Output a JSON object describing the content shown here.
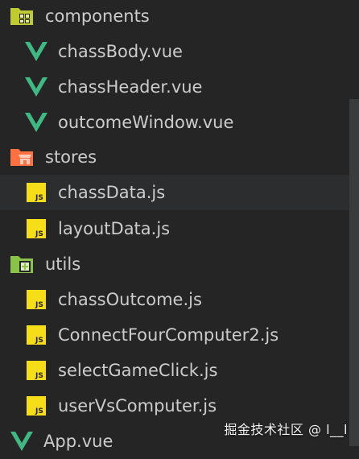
{
  "explorer": {
    "items": [
      {
        "type": "folder",
        "label": "components",
        "icon": "components-folder-icon"
      },
      {
        "type": "file",
        "label": "chassBody.vue",
        "icon": "vue-icon"
      },
      {
        "type": "file",
        "label": "chassHeader.vue",
        "icon": "vue-icon"
      },
      {
        "type": "file",
        "label": "outcomeWindow.vue",
        "icon": "vue-icon"
      },
      {
        "type": "folder",
        "label": "stores",
        "icon": "stores-folder-icon"
      },
      {
        "type": "file",
        "label": "chassData.js",
        "icon": "js-icon",
        "selected": true
      },
      {
        "type": "file",
        "label": "layoutData.js",
        "icon": "js-icon"
      },
      {
        "type": "folder",
        "label": "utils",
        "icon": "utils-folder-icon"
      },
      {
        "type": "file",
        "label": "chassOutcome.js",
        "icon": "js-icon"
      },
      {
        "type": "file",
        "label": "ConnectFourComputer2.js",
        "icon": "js-icon"
      },
      {
        "type": "file",
        "label": "selectGameClick.js",
        "icon": "js-icon"
      },
      {
        "type": "file",
        "label": "userVsComputer.js",
        "icon": "js-icon"
      },
      {
        "type": "file",
        "label": "App.vue",
        "icon": "vue-icon"
      }
    ]
  },
  "watermark": {
    "text": "掘金技术社区 @ l__l"
  },
  "colors": {
    "background": "#252526",
    "selected_row": "#2c2d2f",
    "text": "#cccccc",
    "vue_green": "#41b883",
    "js_yellow": "#f5de19",
    "components_folder": "#c0ca33",
    "stores_folder": "#ff7043",
    "utils_folder": "#8bc34a"
  }
}
